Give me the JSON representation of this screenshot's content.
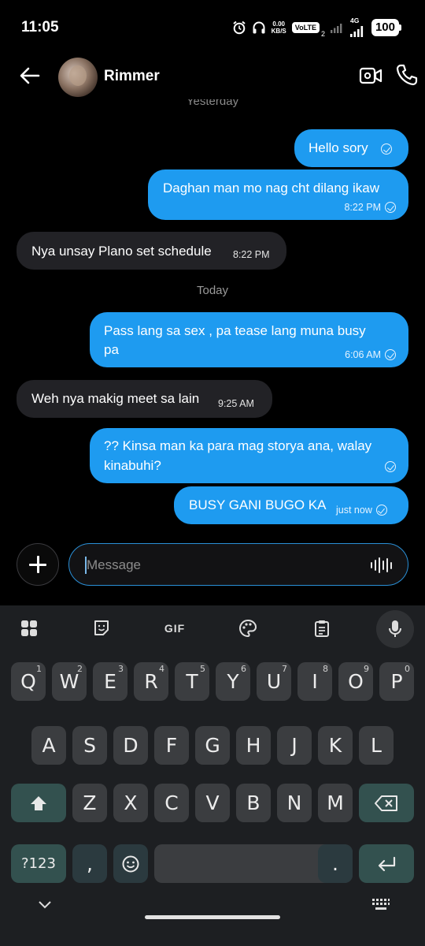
{
  "status_bar": {
    "time": "11:05",
    "speed_value": "0.00",
    "speed_unit": "KB/S",
    "volte": "VoLTE",
    "sim": "2",
    "network": "4G",
    "battery": "100"
  },
  "header": {
    "contact_name": "Rimmer",
    "icons": [
      "back-arrow-icon",
      "video-call-icon",
      "phone-call-icon"
    ]
  },
  "chat": {
    "date_yesterday": "Yesterday",
    "date_today": "Today",
    "messages": [
      {
        "dir": "out",
        "text": "Hello sory",
        "time": ""
      },
      {
        "dir": "out",
        "text": "Daghan man mo nag cht dilang ikaw",
        "time": "8:22 PM"
      },
      {
        "dir": "in",
        "text": "Nya unsay Plano set schedule",
        "time": "8:22 PM"
      },
      {
        "dir": "out",
        "text": "Pass lang sa sex , pa tease lang muna busy",
        "text2": "pa",
        "time": "6:06 AM"
      },
      {
        "dir": "in",
        "text": "Weh nya makig meet sa lain",
        "time": "9:25 AM"
      },
      {
        "dir": "out",
        "text": "?? Kinsa man ka para mag storya ana, walay",
        "text2": "kinabuhi?",
        "time": ""
      },
      {
        "dir": "out",
        "text": "BUSY GANI BUGO KA",
        "time": "just now"
      }
    ]
  },
  "composer": {
    "placeholder": "Message"
  },
  "keyboard": {
    "toolbar": [
      "apps-grid-icon",
      "sticker-icon",
      "GIF",
      "palette-icon",
      "clipboard-icon",
      "mic-icon"
    ],
    "row1": [
      "Q",
      "W",
      "E",
      "R",
      "T",
      "Y",
      "U",
      "I",
      "O",
      "P"
    ],
    "row1_hints": [
      "1",
      "2",
      "3",
      "4",
      "5",
      "6",
      "7",
      "8",
      "9",
      "0"
    ],
    "row2": [
      "A",
      "S",
      "D",
      "F",
      "G",
      "H",
      "J",
      "K",
      "L"
    ],
    "row3": [
      "Z",
      "X",
      "C",
      "V",
      "B",
      "N",
      "M"
    ],
    "symbols_key": "?123",
    "comma_key": ",",
    "period_key": "."
  }
}
